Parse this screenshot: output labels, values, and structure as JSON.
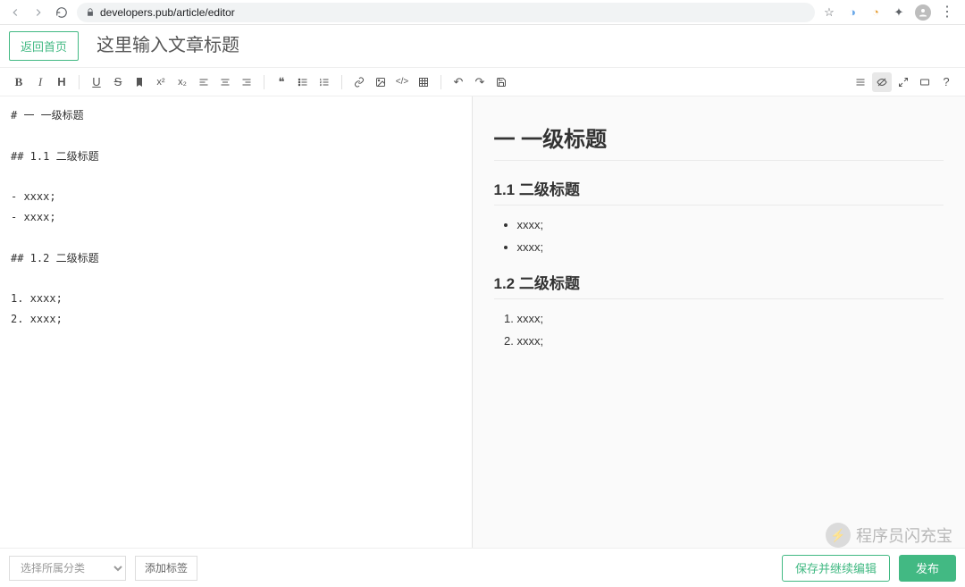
{
  "browser": {
    "url": "developers.pub/article/editor"
  },
  "header": {
    "back_label": "返回首页",
    "title_placeholder": "这里输入文章标题"
  },
  "toolbar": {
    "bold": "B",
    "italic": "I",
    "heading": "H",
    "underline": "U",
    "strike": "S",
    "mark": "❚",
    "sup": "x²",
    "sub": "x₂",
    "align_left": "≡",
    "align_center": "≡",
    "align_right": "≡",
    "quote": "❝",
    "ul": "≣",
    "ol": "≣",
    "link": "🔗",
    "image": "▣",
    "code": "</>",
    "table": "▦",
    "undo": "↶",
    "redo": "↷",
    "save": "🖫",
    "outline": "≡",
    "preview": "👁",
    "fullscreen": "⤢",
    "read": "▭",
    "help": "?"
  },
  "source": {
    "text": "# 一 一级标题\n\n## 1.1 二级标题\n\n- xxxx;\n- xxxx;\n\n## 1.2 二级标题\n\n1. xxxx;\n2. xxxx;"
  },
  "preview": {
    "h1": "一 一级标题",
    "h2_1": "1.1 二级标题",
    "ul": [
      "xxxx;",
      "xxxx;"
    ],
    "h2_2": "1.2 二级标题",
    "ol": [
      "xxxx;",
      "xxxx;"
    ]
  },
  "footer": {
    "select_placeholder": "选择所属分类",
    "add_tag_label": "添加标签",
    "draft_label": "保存并继续编辑",
    "publish_label": "发布"
  },
  "watermark": {
    "text": "程序员闪充宝"
  }
}
